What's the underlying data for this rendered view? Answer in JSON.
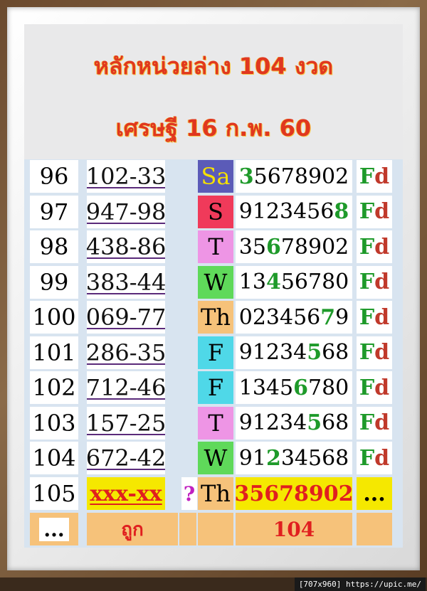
{
  "header": {
    "title": "หลักหน่วยล่าง  104 งวด",
    "subtitle": "เศรษฐี  16 ก.พ. 60"
  },
  "rows": [
    {
      "num": "96",
      "pair": "102-33",
      "day": "Sa",
      "day_color": "sa",
      "digits_pre": "",
      "digits_hl": "3",
      "digits_post": "5678902",
      "fd_f": "F",
      "fd_d": "d"
    },
    {
      "num": "97",
      "pair": "947-98",
      "day": "S",
      "day_color": "s",
      "digits_pre": "9123456",
      "digits_hl": "8",
      "digits_post": "",
      "fd_f": "F",
      "fd_d": "d"
    },
    {
      "num": "98",
      "pair": "438-86",
      "day": "T",
      "day_color": "t",
      "digits_pre": "35",
      "digits_hl": "6",
      "digits_post": "78902",
      "fd_f": "F",
      "fd_d": "d"
    },
    {
      "num": "99",
      "pair": "383-44",
      "day": "W",
      "day_color": "w",
      "digits_pre": "13",
      "digits_hl": "4",
      "digits_post": "56780",
      "fd_f": "F",
      "fd_d": "d"
    },
    {
      "num": "100",
      "pair": "069-77",
      "day": "Th",
      "day_color": "th",
      "digits_pre": "023456",
      "digits_hl": "7",
      "digits_post": "9",
      "fd_f": "F",
      "fd_d": "d"
    },
    {
      "num": "101",
      "pair": "286-35",
      "day": "F",
      "day_color": "f",
      "digits_pre": "91234",
      "digits_hl": "5",
      "digits_post": "68",
      "fd_f": "F",
      "fd_d": "d"
    },
    {
      "num": "102",
      "pair": "712-46",
      "day": "F",
      "day_color": "f",
      "digits_pre": "1345",
      "digits_hl": "6",
      "digits_post": "780",
      "fd_f": "F",
      "fd_d": "d"
    },
    {
      "num": "103",
      "pair": "157-25",
      "day": "T",
      "day_color": "t",
      "digits_pre": "91234",
      "digits_hl": "5",
      "digits_post": "68",
      "fd_f": "F",
      "fd_d": "d"
    },
    {
      "num": "104",
      "pair": "672-42",
      "day": "W",
      "day_color": "w",
      "digits_pre": "91",
      "digits_hl": "2",
      "digits_post": "34568",
      "fd_f": "F",
      "fd_d": "d"
    }
  ],
  "current": {
    "num": "105",
    "pair": "xxx-xx",
    "question": "?",
    "day": "Th",
    "digits": "35678902",
    "fd": "..."
  },
  "footer": {
    "dots": "...",
    "label": "ถูก",
    "count": "104"
  },
  "watermark": "[707x960] https://upic.me/",
  "colors": {
    "title": "#e0371f",
    "highlight_digit": "#1e9a2a",
    "fd_f": "#1e9a2a",
    "fd_d": "#c0392b",
    "current_bg": "#f5e800",
    "footer_bg": "#f6c27a"
  }
}
